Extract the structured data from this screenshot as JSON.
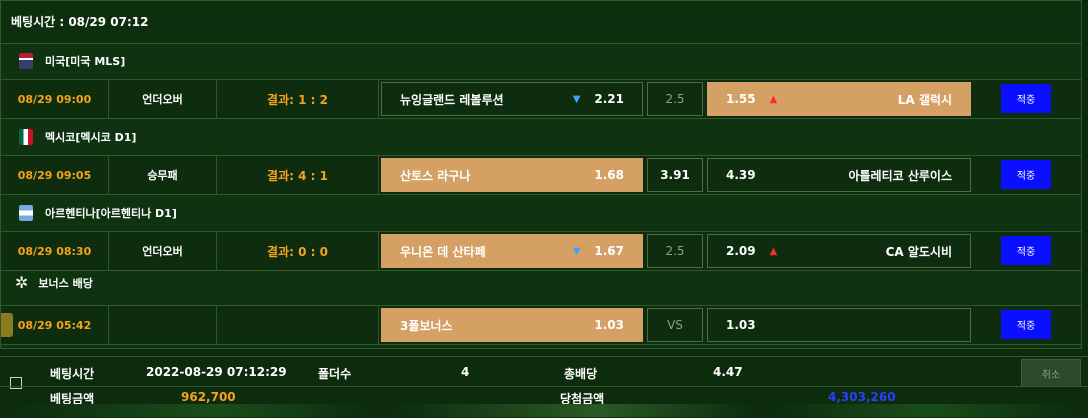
{
  "header": {
    "betting_time_label": "베팅시간 : 08/29 07:12"
  },
  "leagues": [
    {
      "name": "미국[미국 MLS]",
      "flag_color": "#b22234"
    },
    {
      "name": "멕시코[멕시코 D1]",
      "flag_color": "#006847"
    },
    {
      "name": "아르헨티나[아르헨티나 D1]",
      "flag_color": "#74acdf"
    },
    {
      "name": "보너스 배당",
      "icon": "bonus-sparkle-icon"
    }
  ],
  "rows": [
    {
      "time": "08/29 09:00",
      "type": "언더오버",
      "result": "결과: 1 : 2",
      "home_name": "뉴잉글랜드 레볼루션",
      "home_odds": "2.21",
      "home_arrow": "down",
      "draw": "2.5",
      "away_odds": "1.55",
      "away_name": "LA 갤럭시",
      "away_arrow": "up",
      "selected": "away",
      "button": "적중"
    },
    {
      "time": "08/29 09:05",
      "type": "승무패",
      "result": "결과: 4 : 1",
      "home_name": "산토스 라구나",
      "home_odds": "1.68",
      "draw": "3.91",
      "away_odds": "4.39",
      "away_name": "아틀레티코 산루이스",
      "selected": "home",
      "button": "적중"
    },
    {
      "time": "08/29 08:30",
      "type": "언더오버",
      "result": "결과: 0 : 0",
      "home_name": "우니온 데 산타페",
      "home_odds": "1.67",
      "home_arrow": "down",
      "draw": "2.5",
      "away_odds": "2.09",
      "away_name": "CA 알도시비",
      "away_arrow": "up",
      "selected": "home",
      "button": "적중"
    },
    {
      "time": "08/29 05:42",
      "type": "",
      "result": "",
      "home_name": "3폴보너스",
      "home_odds": "1.03",
      "draw": "VS",
      "away_odds": "1.03",
      "away_name": "",
      "selected": "home",
      "button": "적중"
    }
  ],
  "summary": {
    "bet_time_label": "베팅시간",
    "bet_time_value": "2022-08-29 07:12:29",
    "folder_label": "폴더수",
    "folder_value": "4",
    "total_odds_label": "총배당",
    "total_odds_value": "4.47",
    "bet_amount_label": "베팅금액",
    "bet_amount_value": "962,700",
    "win_amount_label": "당첨금액",
    "win_amount_value": "4,303,260",
    "cancel_label": "취소"
  },
  "colors": {
    "accent_orange": "#f6a21c",
    "selected_bg": "#d4a064",
    "button_blue": "#0a10ff",
    "win_amount_blue": "#2a40ff"
  }
}
